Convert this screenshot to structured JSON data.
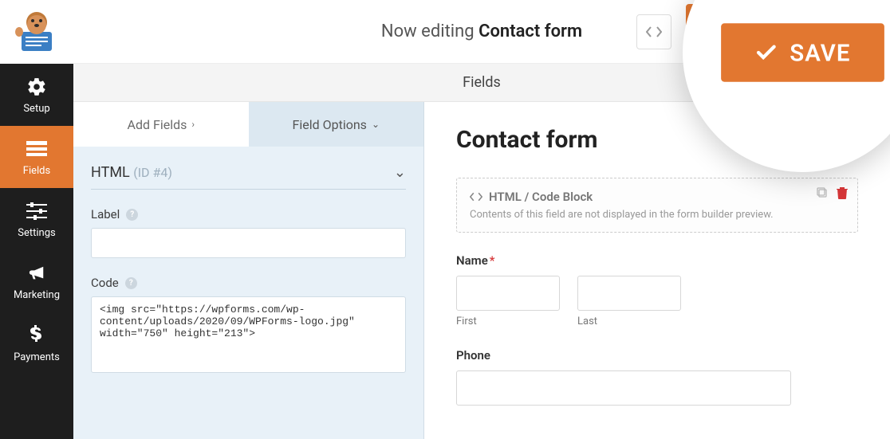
{
  "logo_alt": "WPForms",
  "editing_prefix": "Now editing ",
  "editing_formname": "Contact form",
  "save_label": "SAVE",
  "close_label": "×",
  "section_title": "Fields",
  "sidebar": [
    {
      "label": "Setup"
    },
    {
      "label": "Fields"
    },
    {
      "label": "Settings"
    },
    {
      "label": "Marketing"
    },
    {
      "label": "Payments"
    }
  ],
  "tabs": {
    "add": "Add Fields",
    "options": "Field Options"
  },
  "fo": {
    "type": "HTML",
    "id": "(ID #4)",
    "label_label": "Label",
    "label_value": "",
    "code_label": "Code",
    "code_value": "<img src=\"https://wpforms.com/wp-content/uploads/2020/09/WPForms-logo.jpg\" width=\"750\" height=\"213\">"
  },
  "preview": {
    "title": "Contact form",
    "htmlblock_title": "HTML / Code Block",
    "htmlblock_note": "Contents of this field are not displayed in the form builder preview.",
    "name_label": "Name",
    "first": "First",
    "last": "Last",
    "phone_label": "Phone"
  }
}
